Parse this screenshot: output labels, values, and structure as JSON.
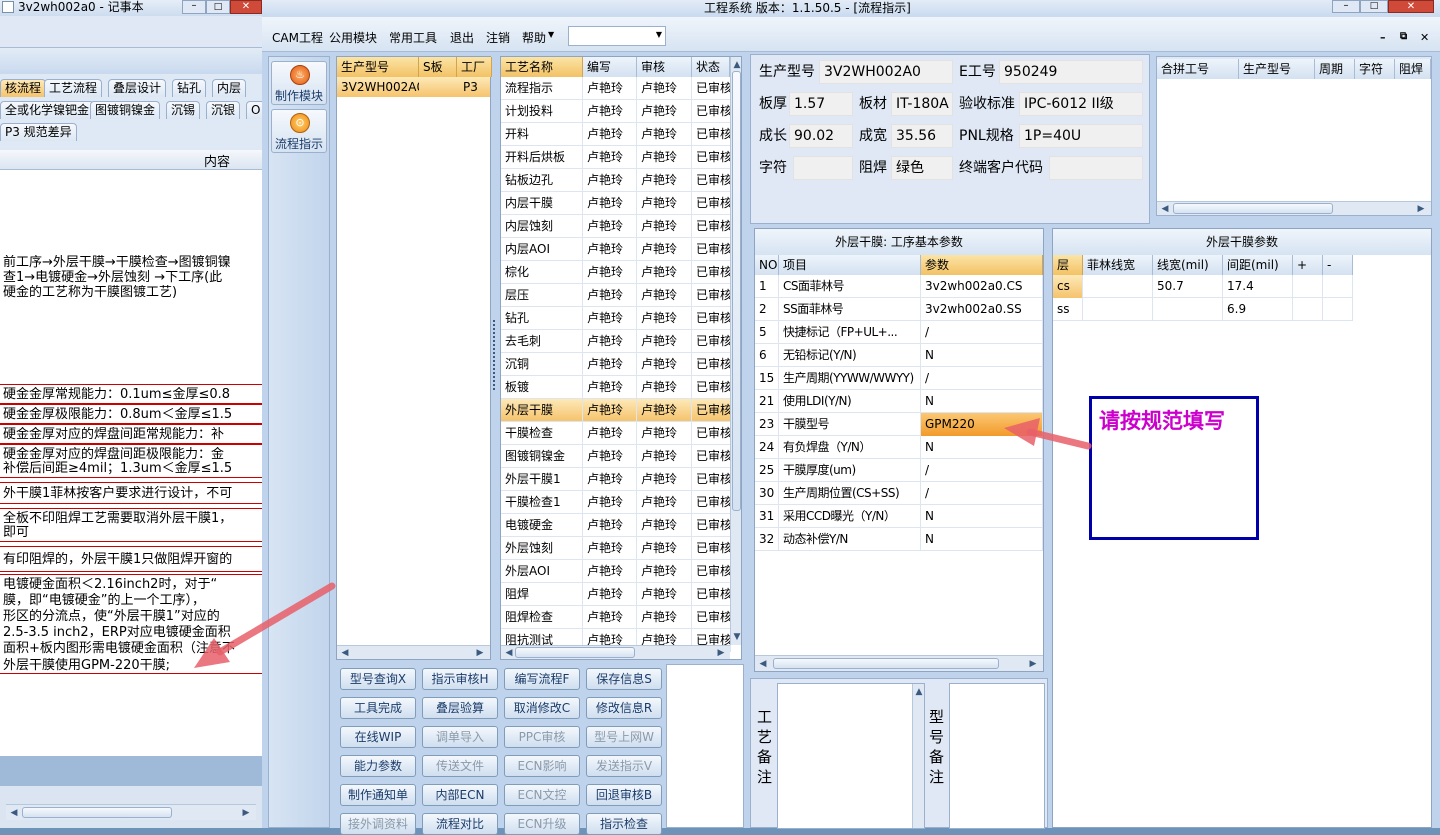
{
  "notepad": {
    "title": "3v2wh002a0 - 记事本",
    "tabs_row1": [
      "核流程",
      "工艺流程",
      "叠层设计",
      "钻孔",
      "内层"
    ],
    "tabs_row2": [
      "全或化学镍钯金",
      "图镀铜镍金",
      "沉锡",
      "沉银",
      "O"
    ],
    "tab_row3": "P3 规范差异",
    "column_header": "内容",
    "lines_a": [
      "前工序→外层干膜→干膜检查→图镀铜镍",
      "查1→电镀硬金→外层蚀刻 →下工序(此",
      "硬金的工艺称为干膜图镀工艺)"
    ],
    "rows": [
      [
        "硬金金厚常规能力：0.1um≤金厚≤0.8"
      ],
      [
        "硬金金厚极限能力：0.8um＜金厚≤1.5"
      ],
      [
        "硬金金厚对应的焊盘间距常规能力：补"
      ],
      [
        "硬金金厚对应的焊盘间距极限能力：金",
        "补偿后间距≥4mil；1.3um＜金厚≤1.5"
      ],
      [
        "外干膜1菲林按客户要求进行设计，不可"
      ],
      [
        "全板不印阻焊工艺需要取消外层干膜1，",
        "即可"
      ],
      [
        "有印阻焊的，外层干膜1只做阻焊开窗的"
      ],
      [
        "电镀硬金面积＜2.16inch2时，对于“",
        "膜，即“电镀硬金”的上一个工序），",
        "形区的分流点，使“外层干膜1”对应的",
        "2.5-3.5 inch2，ERP对应电镀硬金面积",
        "面积+板内图形需电镀硬金面积（注意不",
        "外层干膜使用GPM-220干膜;"
      ]
    ]
  },
  "main": {
    "title": "工程系统   版本：1.1.50.5 - [流程指示]",
    "menu": [
      "CAM工程",
      "公用模块",
      "常用工具",
      "退出",
      "注销",
      "帮助"
    ],
    "side_buttons": [
      "制作模块",
      "流程指示"
    ],
    "model_list": {
      "headers": [
        "生产型号",
        "S板",
        "工厂"
      ],
      "row": [
        "3V2WH002A0",
        "",
        "P3"
      ]
    },
    "process": {
      "headers": [
        "工艺名称",
        "编写",
        "审核",
        "状态"
      ],
      "editor": "卢艳玲",
      "status": "已审核",
      "steps": [
        "流程指示",
        "计划投料",
        "开料",
        "开料后烘板",
        "钻板边孔",
        "内层干膜",
        "内层蚀刻",
        "内层AOI",
        "棕化",
        "层压",
        "钻孔",
        "去毛刺",
        "沉铜",
        "板镀",
        "外层干膜",
        "干膜检查",
        "图镀铜镍金",
        "外层干膜1",
        "干膜检查1",
        "电镀硬金",
        "外层蚀刻",
        "外层AOI",
        "阻焊",
        "阻焊检查",
        "阻抗测试"
      ],
      "selected_index": 14
    },
    "buttons": [
      [
        "型号查询X",
        "指示审核H",
        "编写流程F",
        "保存信息S"
      ],
      [
        "工具完成",
        "叠层验算",
        "取消修改C",
        "修改信息R"
      ],
      [
        "在线WIP",
        "调单导入",
        "PPC审核",
        "型号上网W"
      ],
      [
        "能力参数",
        "传送文件",
        "ECN影响",
        "发送指示V"
      ],
      [
        "制作通知单",
        "内部ECN",
        "ECN文控",
        "回退审核B"
      ],
      [
        "接外调资料",
        "流程对比",
        "ECN升级",
        "指示检查"
      ]
    ],
    "disabled_buttons": [
      "调单导入",
      "PPC审核",
      "型号上网W",
      "传送文件",
      "ECN影响",
      "发送指示V",
      "ECN文控",
      "接外调资料",
      "ECN升级"
    ],
    "info": {
      "model_label": "生产型号",
      "model": "3V2WH002A0",
      "eno_label": "E工号",
      "eno": "950249",
      "thick_label": "板厚",
      "thick": "1.57",
      "mat_label": "板材",
      "mat": "IT-180A",
      "std_label": "验收标准",
      "std": "IPC-6012 II级",
      "len_label": "成长",
      "len": "90.02",
      "wid_label": "成宽",
      "wid": "35.56",
      "pnl_label": "PNL规格",
      "pnl": "1P=40U",
      "char_label": "字符",
      "char": "",
      "mask_label": "阻焊",
      "mask": "绿色",
      "cust_label": "终端客户代码",
      "cust": ""
    },
    "merge": {
      "headers": [
        "合拼工号",
        "生产型号",
        "周期",
        "字符",
        "阻焊"
      ]
    },
    "params": {
      "title": "外层干膜: 工序基本参数",
      "headers": [
        "NO",
        "项目",
        "参数"
      ],
      "rows": [
        [
          "1",
          "CS面菲林号",
          "3v2wh002a0.CS"
        ],
        [
          "2",
          "SS面菲林号",
          "3v2wh002a0.SS"
        ],
        [
          "5",
          "快捷标记（FP+UL+...",
          "/"
        ],
        [
          "6",
          "无铅标记(Y/N)",
          "N"
        ],
        [
          "15",
          "生产周期(YYWW/WWYY)",
          "/"
        ],
        [
          "21",
          "使用LDI(Y/N)",
          "N"
        ],
        [
          "23",
          "干膜型号",
          "GPM220"
        ],
        [
          "24",
          "有负焊盘（Y/N）",
          "N"
        ],
        [
          "25",
          "干膜厚度(um)",
          "/"
        ],
        [
          "30",
          "生产周期位置(CS+SS)",
          "/"
        ],
        [
          "31",
          "采用CCD曝光（Y/N）",
          "N"
        ],
        [
          "32",
          "动态补偿Y/N",
          "N"
        ]
      ],
      "highlight_index": 6
    },
    "film": {
      "title": "外层干膜参数",
      "headers": [
        "层",
        "菲林线宽",
        "线宽(mil)",
        "间距(mil)",
        "+",
        "-"
      ],
      "rows": [
        [
          "cs",
          "",
          "50.7",
          "17.4",
          "",
          ""
        ],
        [
          "ss",
          "",
          "",
          "6.9",
          "",
          ""
        ]
      ]
    },
    "remark_labels": [
      "工艺备注",
      "型号备注"
    ],
    "annotation": "请按规范填写",
    "combo_value": ""
  },
  "colors": {
    "highlight": "#f6a12e",
    "annotation": "#cc00cc",
    "arrow": "#e8606a",
    "frame": "#0000aa"
  }
}
